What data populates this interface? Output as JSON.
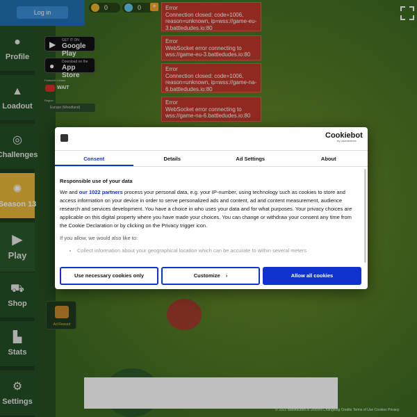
{
  "topbar": {
    "login_label": "Log in",
    "coins_value": "0",
    "gems_value": "0",
    "add_label": "+"
  },
  "store": {
    "google_small": "GET IT ON",
    "google_big": "Google Play",
    "apple_small": "Download on the",
    "apple_big": "App Store"
  },
  "featured": {
    "label": "Featured Creator",
    "creator_name": "WAIT"
  },
  "region": {
    "label": "Region",
    "selected": "Europe (Woodland)"
  },
  "sidebar": {
    "items": [
      {
        "label": "Profile",
        "icon": "user-icon"
      },
      {
        "label": "Loadout",
        "icon": "helmet-icon"
      },
      {
        "label": "Challenges",
        "icon": "target-icon"
      },
      {
        "label": "Season 13",
        "icon": "gear-icon"
      },
      {
        "label": "Play",
        "icon": "play-icon"
      },
      {
        "label": "Shop",
        "icon": "cart-icon"
      },
      {
        "label": "Stats",
        "icon": "stats-icon"
      },
      {
        "label": "Settings",
        "icon": "gear-icon"
      }
    ]
  },
  "reward": {
    "label": "Ad Reward"
  },
  "errors": [
    {
      "title": "Error",
      "message": "Connection closed: code=1006, reason=unknown, ip=wss://game-eu-3.battledudes.io:80"
    },
    {
      "title": "Error",
      "message": "WebSocket error connecting to wss://game-eu-3.battledudes.io:80"
    },
    {
      "title": "Error",
      "message": "Connection closed: code=1006, reason=unknown, ip=wss://game-na-6.battledudes.io:80"
    },
    {
      "title": "Error",
      "message": "WebSocket error connecting to wss://game-na-6.battledudes.io:80"
    }
  ],
  "cookie": {
    "brand": "Cookiebot",
    "brand_sub": "by Usercentrics",
    "tabs": [
      "Consent",
      "Details",
      "Ad Settings",
      "About"
    ],
    "heading": "Responsible use of your data",
    "para_pre": "We and ",
    "partners_link": "our 1022 partners",
    "para_post": " process your personal data, e.g. your IP-number, using technology such as cookies to store and access information on your device in order to serve personalized ads and content, ad and content measurement, audience research and services development. You have a choice in who uses your data and for what purposes. Your privacy choices are applicable on this digital property where you have made your choices. You can change or withdraw your consent any time from the Cookie Declaration or by clicking on the Privacy trigger icon.",
    "allow_intro": "If you allow, we would also like to:",
    "bullet": "Collect information about your geographical location which can be accurate to within several meters",
    "btn_necessary": "Use necessary cookies only",
    "btn_customize": "Customize",
    "btn_allow": "Allow all cookies"
  },
  "footer": {
    "links": "© 2023 Battledudes.io   Discord   Changelog   Credits   Terms of Use   Cookies   Privacy"
  },
  "colors": {
    "season_accent": "#e9b93b",
    "login_blue": "#1f6fb0",
    "error_red": "#c0392b",
    "consent_blue": "#1032cf"
  }
}
